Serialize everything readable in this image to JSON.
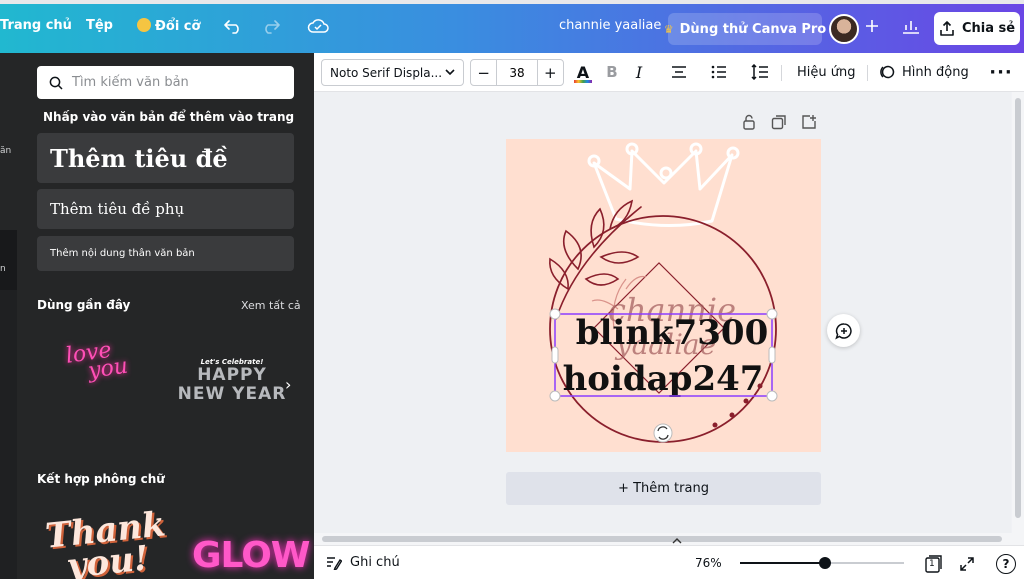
{
  "topbar": {
    "home": "Trang chủ",
    "file": "Tệp",
    "resize": "Đổi cỡ",
    "project_name": "channie yaaliae",
    "trial": "Dùng thử Canva Pro",
    "share": "Chia sẻ",
    "colors": {
      "gradient_start": "#21b8d0",
      "gradient_end": "#6a46e5"
    }
  },
  "rail": {
    "label_1": "ăn",
    "label_2": "n"
  },
  "panel": {
    "search_placeholder": "Tìm kiếm văn bản",
    "hint": "Nhấp vào văn bản để thêm vào trang",
    "heading": "Thêm tiêu đề",
    "subheading": "Thêm tiêu đề phụ",
    "body": "Thêm nội dung thân văn bản",
    "recent_title": "Dùng gần đây",
    "see_all": "Xem tất cả",
    "combo_title": "Kết hợp phông chữ",
    "thumbs": {
      "love1": "love",
      "love2": "you",
      "happy_small": "Let's Celebrate!",
      "happy_big1": "HAPPY",
      "happy_big2": "NEW YEAR",
      "thank1": "Thank",
      "thank2": "you!",
      "glow": "GLOW"
    }
  },
  "toolbar": {
    "font": "Noto Serif Displa...",
    "size": "38",
    "effects": "Hiệu ứng",
    "animate": "Hình động"
  },
  "design": {
    "bg_color": "#ffdfd0",
    "script_text_1": "channie",
    "script_text_2": "yaaliae",
    "main_line_1": "blink7300",
    "main_line_2": "hoidap247"
  },
  "canvas": {
    "add_page": "+ Thêm trang"
  },
  "bottombar": {
    "notes": "Ghi chú",
    "zoom": "76%",
    "zoom_fraction": 0.52,
    "page_count": "1",
    "help": "?"
  }
}
